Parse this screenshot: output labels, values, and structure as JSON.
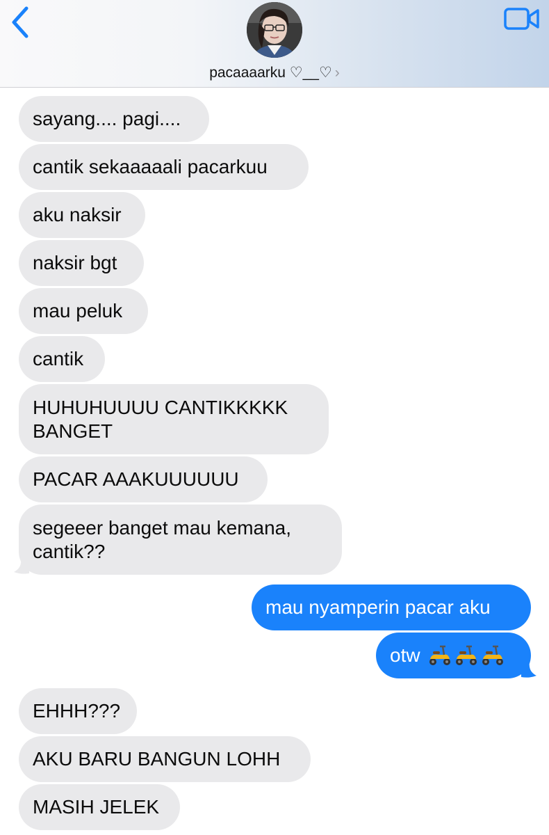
{
  "header": {
    "contact_name": "pacaaaarku ♡__♡",
    "chevron": "›",
    "back_icon": "chevron-left-icon",
    "video_icon": "video-camera-icon",
    "accent_color": "#1a82fb"
  },
  "messages": [
    {
      "direction": "incoming",
      "text": "sayang.... pagi...."
    },
    {
      "direction": "incoming",
      "text": "cantik sekaaaaali pacarkuu"
    },
    {
      "direction": "incoming",
      "text": "aku naksir"
    },
    {
      "direction": "incoming",
      "text": "naksir bgt"
    },
    {
      "direction": "incoming",
      "text": "mau peluk"
    },
    {
      "direction": "incoming",
      "text": "cantik"
    },
    {
      "direction": "incoming",
      "text": "HUHUHUUUU CANTIKKKKK BANGET"
    },
    {
      "direction": "incoming",
      "text": "PACAR AAAKUUUUUU"
    },
    {
      "direction": "incoming",
      "text": "segeeer banget mau kemana, cantik??"
    },
    {
      "direction": "outgoing",
      "text": "mau nyamperin pacar aku"
    },
    {
      "direction": "outgoing",
      "text": "otw",
      "emoji": "scooter-icon ×3"
    },
    {
      "direction": "incoming",
      "text": "EHHH???"
    },
    {
      "direction": "incoming",
      "text": "AKU BARU BANGUN LOHH"
    },
    {
      "direction": "incoming",
      "text": "MASIH JELEK"
    }
  ]
}
